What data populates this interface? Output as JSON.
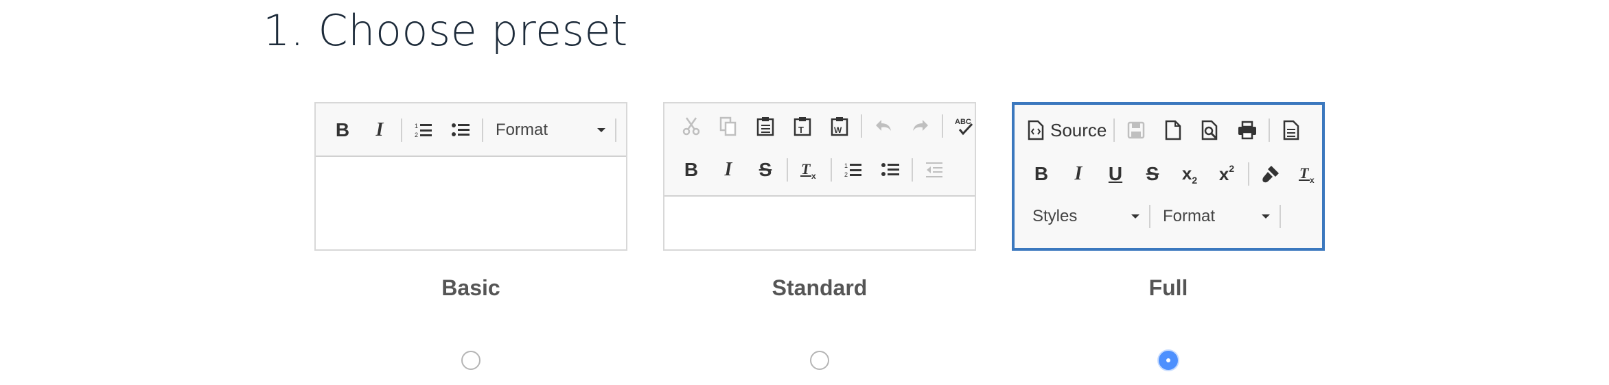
{
  "page": {
    "title": "1. Choose preset"
  },
  "presets": {
    "basic": {
      "label": "Basic",
      "format_combo": "Format",
      "bold": "B",
      "italic": "I",
      "selected": false
    },
    "standard": {
      "label": "Standard",
      "bold": "B",
      "italic": "I",
      "strike": "S",
      "selected": false
    },
    "full": {
      "label": "Full",
      "source_label": "Source",
      "bold": "B",
      "italic": "I",
      "underline": "U",
      "strike": "S",
      "styles_combo": "Styles",
      "format_combo": "Format",
      "selected": true
    }
  },
  "colors": {
    "selected_border": "#3b78be",
    "radio_checked": "#4d90fe",
    "label_text": "#555555",
    "title_text": "#1d2b3a"
  }
}
